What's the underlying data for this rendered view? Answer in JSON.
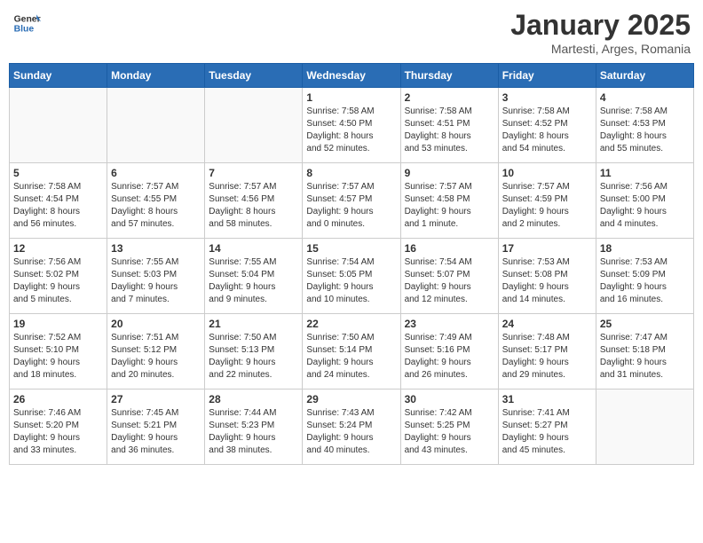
{
  "header": {
    "logo_general": "General",
    "logo_blue": "Blue",
    "title": "January 2025",
    "subtitle": "Martesti, Arges, Romania"
  },
  "weekdays": [
    "Sunday",
    "Monday",
    "Tuesday",
    "Wednesday",
    "Thursday",
    "Friday",
    "Saturday"
  ],
  "weeks": [
    [
      {
        "num": "",
        "info": ""
      },
      {
        "num": "",
        "info": ""
      },
      {
        "num": "",
        "info": ""
      },
      {
        "num": "1",
        "info": "Sunrise: 7:58 AM\nSunset: 4:50 PM\nDaylight: 8 hours\nand 52 minutes."
      },
      {
        "num": "2",
        "info": "Sunrise: 7:58 AM\nSunset: 4:51 PM\nDaylight: 8 hours\nand 53 minutes."
      },
      {
        "num": "3",
        "info": "Sunrise: 7:58 AM\nSunset: 4:52 PM\nDaylight: 8 hours\nand 54 minutes."
      },
      {
        "num": "4",
        "info": "Sunrise: 7:58 AM\nSunset: 4:53 PM\nDaylight: 8 hours\nand 55 minutes."
      }
    ],
    [
      {
        "num": "5",
        "info": "Sunrise: 7:58 AM\nSunset: 4:54 PM\nDaylight: 8 hours\nand 56 minutes."
      },
      {
        "num": "6",
        "info": "Sunrise: 7:57 AM\nSunset: 4:55 PM\nDaylight: 8 hours\nand 57 minutes."
      },
      {
        "num": "7",
        "info": "Sunrise: 7:57 AM\nSunset: 4:56 PM\nDaylight: 8 hours\nand 58 minutes."
      },
      {
        "num": "8",
        "info": "Sunrise: 7:57 AM\nSunset: 4:57 PM\nDaylight: 9 hours\nand 0 minutes."
      },
      {
        "num": "9",
        "info": "Sunrise: 7:57 AM\nSunset: 4:58 PM\nDaylight: 9 hours\nand 1 minute."
      },
      {
        "num": "10",
        "info": "Sunrise: 7:57 AM\nSunset: 4:59 PM\nDaylight: 9 hours\nand 2 minutes."
      },
      {
        "num": "11",
        "info": "Sunrise: 7:56 AM\nSunset: 5:00 PM\nDaylight: 9 hours\nand 4 minutes."
      }
    ],
    [
      {
        "num": "12",
        "info": "Sunrise: 7:56 AM\nSunset: 5:02 PM\nDaylight: 9 hours\nand 5 minutes."
      },
      {
        "num": "13",
        "info": "Sunrise: 7:55 AM\nSunset: 5:03 PM\nDaylight: 9 hours\nand 7 minutes."
      },
      {
        "num": "14",
        "info": "Sunrise: 7:55 AM\nSunset: 5:04 PM\nDaylight: 9 hours\nand 9 minutes."
      },
      {
        "num": "15",
        "info": "Sunrise: 7:54 AM\nSunset: 5:05 PM\nDaylight: 9 hours\nand 10 minutes."
      },
      {
        "num": "16",
        "info": "Sunrise: 7:54 AM\nSunset: 5:07 PM\nDaylight: 9 hours\nand 12 minutes."
      },
      {
        "num": "17",
        "info": "Sunrise: 7:53 AM\nSunset: 5:08 PM\nDaylight: 9 hours\nand 14 minutes."
      },
      {
        "num": "18",
        "info": "Sunrise: 7:53 AM\nSunset: 5:09 PM\nDaylight: 9 hours\nand 16 minutes."
      }
    ],
    [
      {
        "num": "19",
        "info": "Sunrise: 7:52 AM\nSunset: 5:10 PM\nDaylight: 9 hours\nand 18 minutes."
      },
      {
        "num": "20",
        "info": "Sunrise: 7:51 AM\nSunset: 5:12 PM\nDaylight: 9 hours\nand 20 minutes."
      },
      {
        "num": "21",
        "info": "Sunrise: 7:50 AM\nSunset: 5:13 PM\nDaylight: 9 hours\nand 22 minutes."
      },
      {
        "num": "22",
        "info": "Sunrise: 7:50 AM\nSunset: 5:14 PM\nDaylight: 9 hours\nand 24 minutes."
      },
      {
        "num": "23",
        "info": "Sunrise: 7:49 AM\nSunset: 5:16 PM\nDaylight: 9 hours\nand 26 minutes."
      },
      {
        "num": "24",
        "info": "Sunrise: 7:48 AM\nSunset: 5:17 PM\nDaylight: 9 hours\nand 29 minutes."
      },
      {
        "num": "25",
        "info": "Sunrise: 7:47 AM\nSunset: 5:18 PM\nDaylight: 9 hours\nand 31 minutes."
      }
    ],
    [
      {
        "num": "26",
        "info": "Sunrise: 7:46 AM\nSunset: 5:20 PM\nDaylight: 9 hours\nand 33 minutes."
      },
      {
        "num": "27",
        "info": "Sunrise: 7:45 AM\nSunset: 5:21 PM\nDaylight: 9 hours\nand 36 minutes."
      },
      {
        "num": "28",
        "info": "Sunrise: 7:44 AM\nSunset: 5:23 PM\nDaylight: 9 hours\nand 38 minutes."
      },
      {
        "num": "29",
        "info": "Sunrise: 7:43 AM\nSunset: 5:24 PM\nDaylight: 9 hours\nand 40 minutes."
      },
      {
        "num": "30",
        "info": "Sunrise: 7:42 AM\nSunset: 5:25 PM\nDaylight: 9 hours\nand 43 minutes."
      },
      {
        "num": "31",
        "info": "Sunrise: 7:41 AM\nSunset: 5:27 PM\nDaylight: 9 hours\nand 45 minutes."
      },
      {
        "num": "",
        "info": ""
      }
    ]
  ]
}
